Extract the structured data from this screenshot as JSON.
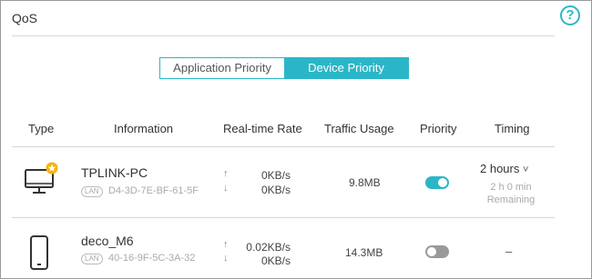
{
  "header": {
    "title": "QoS",
    "help_icon": "question-circle-icon"
  },
  "tabs": [
    {
      "label": "Application Priority",
      "active": false
    },
    {
      "label": "Device Priority",
      "active": true
    }
  ],
  "table": {
    "columns": [
      "Type",
      "Information",
      "Real-time Rate",
      "Traffic Usage",
      "Priority",
      "Timing"
    ],
    "rows": [
      {
        "type_icon": "desktop-computer-icon",
        "badge_icon": "star-badge-icon",
        "name": "TPLINK-PC",
        "conn": "LAN",
        "mac": "D4-3D-7E-BF-61-5F",
        "up_rate": "0KB/s",
        "down_rate": "0KB/s",
        "usage": "9.8MB",
        "priority_on": true,
        "timing": "2 hours",
        "timing_caret": "˅",
        "remaining_time": "2 h 0 min",
        "remaining_label": "Remaining"
      },
      {
        "type_icon": "smartphone-icon",
        "name": "deco_M6",
        "conn": "LAN",
        "mac": "40-16-9F-5C-3A-32",
        "up_rate": "0.02KB/s",
        "down_rate": "0KB/s",
        "usage": "14.3MB",
        "priority_on": false,
        "timing": "–"
      }
    ]
  },
  "colors": {
    "accent": "#2bb6c8",
    "toggle_off": "#9a9a9a",
    "text": "#333333",
    "muted": "#aaaaaa"
  }
}
